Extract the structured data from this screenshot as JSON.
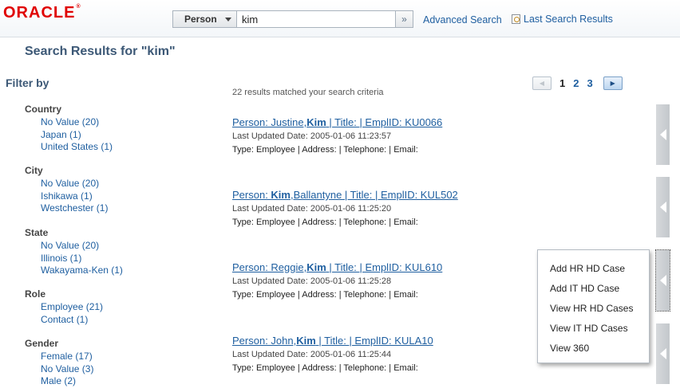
{
  "header": {
    "logo_text": "ORACLE",
    "logo_mark": "®",
    "search_type": "Person",
    "search_value": "kim",
    "advanced_search": "Advanced Search",
    "last_search_results": "Last Search Results"
  },
  "page": {
    "results_title": "Search Results for \"kim\"",
    "match_count": "22 results matched your search criteria"
  },
  "filter": {
    "title": "Filter by",
    "groups": [
      {
        "title": "Country",
        "items": [
          "No Value (20)",
          "Japan (1)",
          "United States (1)"
        ]
      },
      {
        "title": "City",
        "items": [
          "No Value (20)",
          "Ishikawa (1)",
          "Westchester (1)"
        ]
      },
      {
        "title": "State",
        "items": [
          "No Value (20)",
          "Illinois (1)",
          "Wakayama-Ken (1)"
        ]
      },
      {
        "title": "Role",
        "items": [
          "Employee (21)",
          "Contact (1)"
        ]
      },
      {
        "title": "Gender",
        "items": [
          "Female (17)",
          "No Value (3)",
          "Male (2)"
        ]
      }
    ]
  },
  "pager": {
    "pages": [
      "1",
      "2",
      "3"
    ],
    "current": "1"
  },
  "results": [
    {
      "pre": "Person: Justine,",
      "bold": "Kim",
      "post": " | Title: | EmplID: KU0066",
      "date": "Last Updated Date: 2005-01-06 11:23:57",
      "type": "Type: Employee | Address: | Telephone: | Email:"
    },
    {
      "pre": "Person: ",
      "bold": "Kim",
      "post": ",Ballantyne | Title: | EmplID: KUL502",
      "date": "Last Updated Date: 2005-01-06 11:25:20",
      "type": "Type: Employee | Address: | Telephone: | Email:"
    },
    {
      "pre": "Person: Reggie,",
      "bold": "Kim",
      "post": " | Title: | EmplID: KUL610",
      "date": "Last Updated Date: 2005-01-06 11:25:28",
      "type": "Type: Employee | Address: | Telephone: | Email:"
    },
    {
      "pre": "Person: John,",
      "bold": "Kim",
      "post": " | Title: | EmplID: KULA10",
      "date": "Last Updated Date: 2005-01-06 11:25:44",
      "type": "Type: Employee | Address: | Telephone: | Email:"
    }
  ],
  "context_menu": {
    "items": [
      "Add HR HD Case",
      "Add IT HD Case",
      "View HR HD Cases",
      "View IT HD Cases",
      "View 360"
    ]
  },
  "icons": {
    "pager_prev": "chevron-left-icon",
    "pager_next": "chevron-right-icon",
    "search_go": "double-chevron-right-icon",
    "side_tab": "triangle-left-icon"
  },
  "colors": {
    "link": "#1f5fa0",
    "heading": "#3c5876",
    "brand": "#e00000"
  }
}
